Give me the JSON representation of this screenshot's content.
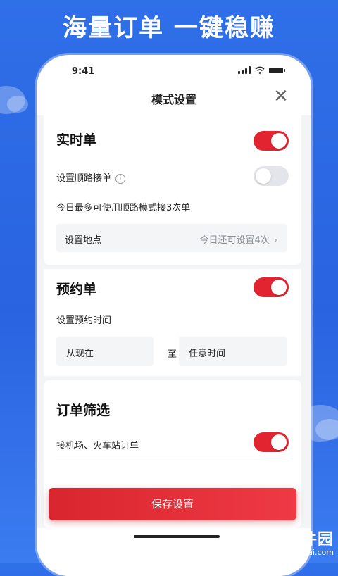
{
  "banner": {
    "headline": "海量订单  一键稳赚"
  },
  "status_bar": {
    "time": "9:41"
  },
  "nav": {
    "title": "模式设置",
    "close": "✕"
  },
  "realtime": {
    "title": "实时单",
    "toggle_on": true,
    "route_label": "设置顺路接单",
    "route_toggle_on": false,
    "note": "今日最多可使用顺路模式接3次单",
    "location_label": "设置地点",
    "location_value": "今日还可设置4次",
    "location_chevron": "›"
  },
  "reservation": {
    "title": "预约单",
    "toggle_on": true,
    "time_label": "设置预约时间",
    "from": "从现在",
    "to_label": "至",
    "to": "任意时间"
  },
  "filter": {
    "title": "订单筛选",
    "airport_label": "接机场、火车站订单",
    "airport_toggle_on": true
  },
  "save_button": "保存设置",
  "watermark": {
    "brand": "谷普软件园",
    "url": "www.gupuxiazai.com"
  },
  "colors": {
    "accent": "#e1242f",
    "background_blue": "#2f6fe8"
  }
}
